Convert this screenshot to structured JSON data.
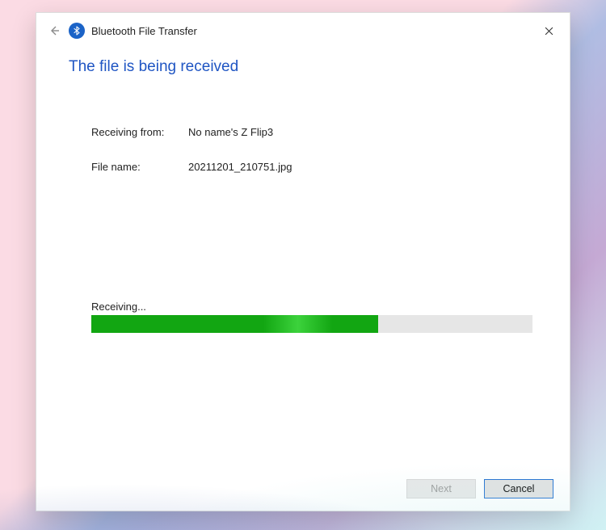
{
  "window": {
    "title": "Bluetooth File Transfer",
    "icon_name": "bluetooth-icon"
  },
  "heading": "The file is being received",
  "details": {
    "from_label": "Receiving from:",
    "from_value": "No name's Z Flip3",
    "file_label": "File name:",
    "file_value": "20211201_210751.jpg"
  },
  "progress": {
    "label": "Receiving...",
    "percent": 65
  },
  "footer": {
    "next_label": "Next",
    "cancel_label": "Cancel"
  }
}
